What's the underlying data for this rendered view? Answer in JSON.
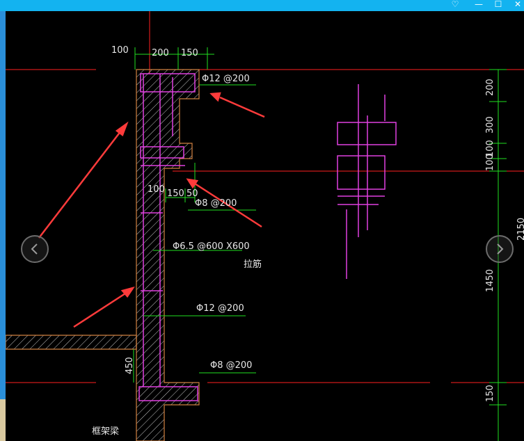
{
  "window": {
    "minimize_glyph": "—",
    "maximize_glyph": "☐",
    "close_glyph": "✕",
    "help_glyph": "♡"
  },
  "dimensions": {
    "top_left": "100",
    "top_mid": "200",
    "top_right": "150",
    "mid_100": "100",
    "mid_150": "150",
    "mid_50": "50",
    "left_450": "450",
    "right_200": "200",
    "right_300": "300",
    "right_100_a": "100",
    "right_100_b": "100",
    "right_2150": "2150",
    "right_1450": "1450",
    "right_150": "150"
  },
  "rebar": {
    "label_1": "Φ12 @200",
    "label_2": "Φ8 @200",
    "label_3": "Φ6.5 @600 X600",
    "label_3_note": "拉筋",
    "label_4": "Φ12 @200",
    "label_5": "Φ8 @200"
  },
  "labels": {
    "frame_beam": "框架梁"
  },
  "colors": {
    "titlebar": "#13b3f0",
    "red_line": "#ff2020",
    "magenta": "#e040e0",
    "green": "#20e020",
    "orange": "#d08040",
    "arrow": "#ff3b3b"
  }
}
